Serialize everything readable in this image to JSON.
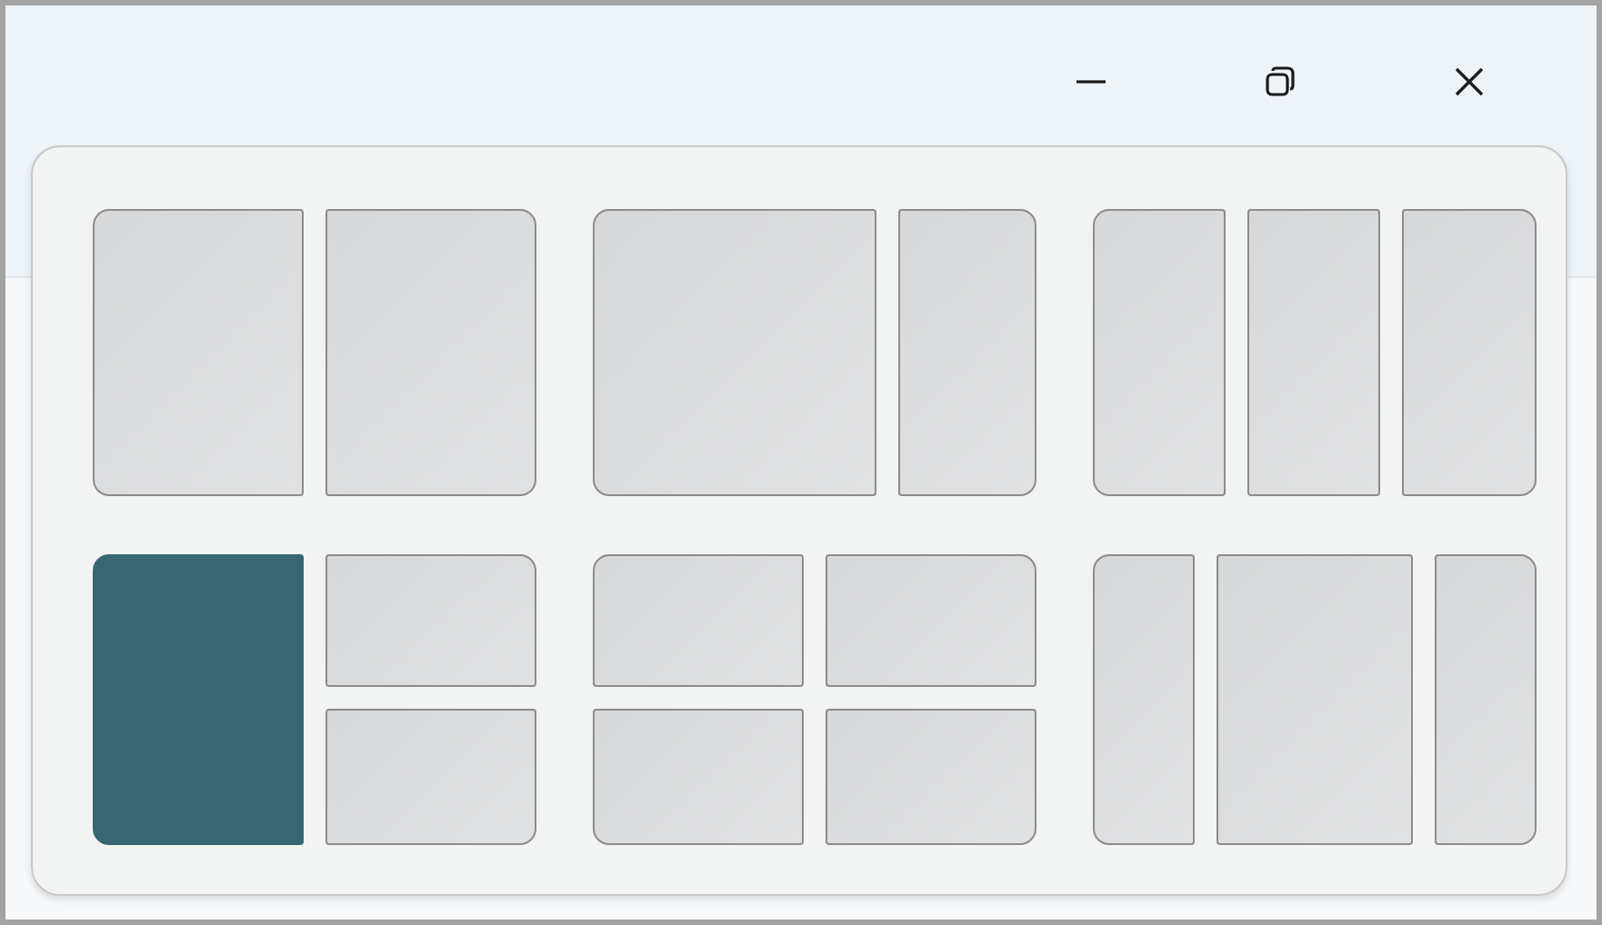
{
  "caption_buttons": [
    {
      "kind": "minimize"
    },
    {
      "kind": "restore"
    },
    {
      "kind": "close"
    }
  ],
  "snap_layouts": [
    {
      "kind": "halves",
      "zones": [
        {
          "selected": false
        },
        {
          "selected": false
        }
      ]
    },
    {
      "kind": "two-thirds",
      "zones": [
        {
          "selected": false
        },
        {
          "selected": false
        }
      ]
    },
    {
      "kind": "thirds",
      "zones": [
        {
          "selected": false
        },
        {
          "selected": false
        },
        {
          "selected": false
        }
      ]
    },
    {
      "kind": "main-stack",
      "zones": [
        {
          "selected": true
        },
        {
          "selected": false
        },
        {
          "selected": false
        }
      ]
    },
    {
      "kind": "quadrants",
      "zones": [
        {
          "selected": false
        },
        {
          "selected": false
        },
        {
          "selected": false
        },
        {
          "selected": false
        }
      ]
    },
    {
      "kind": "wide-center",
      "zones": [
        {
          "selected": false
        },
        {
          "selected": false
        },
        {
          "selected": false
        }
      ]
    }
  ]
}
